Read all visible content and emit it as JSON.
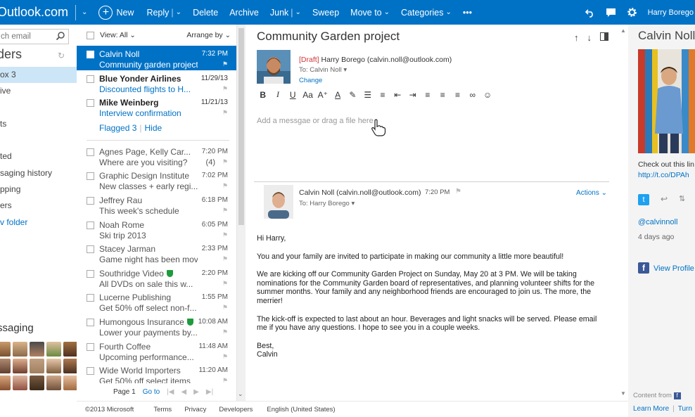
{
  "topbar": {
    "brand": "Outlook.com",
    "new": "New",
    "reply": "Reply",
    "delete": "Delete",
    "archive": "Archive",
    "junk": "Junk",
    "sweep": "Sweep",
    "move_to": "Move to",
    "categories": "Categories",
    "more": "•••",
    "user": "Harry Borego",
    "color": "#0072c6"
  },
  "folders": {
    "search_placeholder": "ch email",
    "title": "ders",
    "items": [
      {
        "label": "ox  3"
      },
      {
        "label": "ive"
      },
      {
        "label": ""
      },
      {
        "label": "ts"
      },
      {
        "label": ""
      },
      {
        "label": "ted"
      },
      {
        "label": "saging history"
      },
      {
        "label": "pping"
      },
      {
        "label": "ers"
      },
      {
        "label": "v folder"
      }
    ],
    "messaging_title": "ssaging"
  },
  "list": {
    "view": "View: All",
    "arrange": "Arrange by",
    "rows": [
      {
        "from": "Calvin Noll",
        "subject": "Community garden project",
        "time": "7:32 PM"
      },
      {
        "from": "Blue Yonder Airlines",
        "subject": "Discounted flights to H...",
        "time": "11/29/13"
      },
      {
        "from": "Mike Weinberg",
        "subject": "Interview confirmation",
        "time": "11/21/13"
      }
    ],
    "flagged": "Flagged 3",
    "hide": "Hide",
    "read_rows": [
      {
        "from": "Agnes Page, Kelly Car...",
        "subject": "Where are you visiting?",
        "time": "7:20 PM",
        "count": "(4)"
      },
      {
        "from": "Graphic Design Institute",
        "subject": "New classes + early regi...",
        "time": "7:02 PM"
      },
      {
        "from": "Jeffrey Rau",
        "subject": "This week's schedule",
        "time": "6:18 PM"
      },
      {
        "from": "Noah Rome",
        "subject": "Ski trip 2013",
        "time": "6:05 PM"
      },
      {
        "from": "Stacey Jarman",
        "subject": "Game night has been mov...",
        "time": "2:33 PM"
      },
      {
        "from": "Southridge Video",
        "subject": "All DVDs on sale this w...",
        "time": "2:20 PM"
      },
      {
        "from": "Lucerne Publishing",
        "subject": "Get 50% off select non-f...",
        "time": "1:55 PM"
      },
      {
        "from": "Humongous Insurance",
        "subject": "Lower your payments by...",
        "time": "10:08 AM"
      },
      {
        "from": "Fourth Coffee",
        "subject": "Upcoming performance...",
        "time": "11:48 AM"
      },
      {
        "from": "Wide World Importers",
        "subject": "Get 50% off select items",
        "time": "11:20 AM"
      }
    ],
    "pager": {
      "page": "Page 1",
      "goto": "Go to"
    }
  },
  "reading": {
    "subject": "Community Garden project",
    "draft_tag": "[Draft]",
    "draft_from": "Harry Borego (calvin.noll@outlook.com)",
    "draft_to": "To: Calvin Noll",
    "change": "Change",
    "compose_placeholder": "Add a messgae or drag a file here",
    "msg_from": "Calvin Noll (calvin.noll@outlook.com)",
    "msg_time": "7:20 PM",
    "msg_to": "To: Harry Borego",
    "actions": "Actions",
    "body": {
      "greeting": "Hi Harry,",
      "p1": "You and your family are invited to participate in making our community a little more beautiful!",
      "p2": "We are kicking off our Community Garden Project on Sunday, May 20 at 3 PM. We will be taking nominations for the Community Garden board of representatives, and planning volunteer shifts for the summer months. Your family and any neighborhood friends are encouraged to join us. The more, the merrier!",
      "p3": "The kick-off is expected to last about an hour. Beverages and light snacks will be served. Please email me if you have any questions. I hope to see you in a couple weeks.",
      "sign1": "Best,",
      "sign2": "Calvin"
    }
  },
  "people": {
    "name": "Calvin Noll",
    "post": "Check out this lin",
    "link": "http://t.co/DPAh",
    "handle": "@calvinnoll",
    "ago": "4 days ago",
    "view_profile": "View Profile",
    "content_from": "Content from",
    "learn_more": "Learn More",
    "turn": "Turn"
  },
  "footer": {
    "copyright": "©2013 Microsoft",
    "terms": "Terms",
    "privacy": "Privacy",
    "developers": "Developers",
    "language": "English (United States)"
  }
}
